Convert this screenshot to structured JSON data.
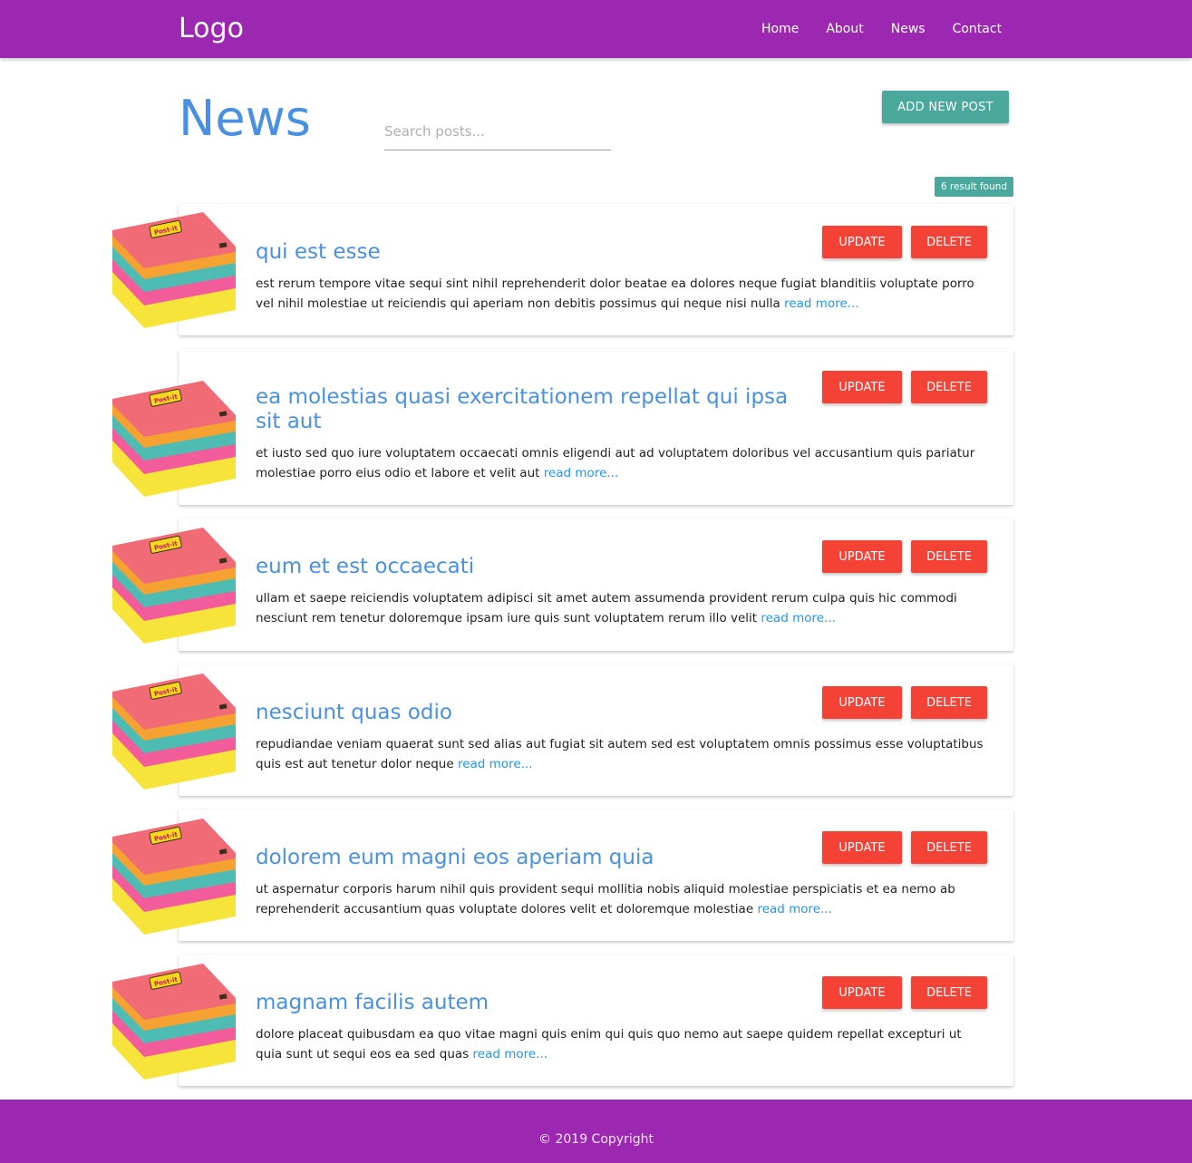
{
  "navbar": {
    "logo": "Logo",
    "links": [
      "Home",
      "About",
      "News",
      "Contact"
    ]
  },
  "header": {
    "title": "News",
    "search_placeholder": "Search posts...",
    "add_button": "ADD NEW POST",
    "result_badge": "6 result found"
  },
  "post_actions": {
    "update_label": "UPDATE",
    "delete_label": "DELETE",
    "read_more_label": "read more..."
  },
  "posts": [
    {
      "title": "qui est esse",
      "excerpt": "est rerum tempore vitae sequi sint nihil reprehenderit dolor beatae ea dolores neque fugiat blanditiis voluptate porro vel nihil molestiae ut reiciendis qui aperiam non debitis possimus qui neque nisi nulla"
    },
    {
      "title": "ea molestias quasi exercitationem repellat qui ipsa sit aut",
      "excerpt": "et iusto sed quo iure voluptatem occaecati omnis eligendi aut ad voluptatem doloribus vel accusantium quis pariatur molestiae porro eius odio et labore et velit aut"
    },
    {
      "title": "eum et est occaecati",
      "excerpt": "ullam et saepe reiciendis voluptatem adipisci sit amet autem assumenda provident rerum culpa quis hic commodi nesciunt rem tenetur doloremque ipsam iure quis sunt voluptatem rerum illo velit"
    },
    {
      "title": "nesciunt quas odio",
      "excerpt": "repudiandae veniam quaerat sunt sed alias aut fugiat sit autem sed est voluptatem omnis possimus esse voluptatibus quis est aut tenetur dolor neque"
    },
    {
      "title": "dolorem eum magni eos aperiam quia",
      "excerpt": "ut aspernatur corporis harum nihil quis provident sequi mollitia nobis aliquid molestiae perspiciatis et ea nemo ab reprehenderit accusantium quas voluptate dolores velit et doloremque molestiae"
    },
    {
      "title": "magnam facilis autem",
      "excerpt": "dolore placeat quibusdam ea quo vitae magni quis enim qui quis quo nemo aut saepe quidem repellat excepturi ut quia sunt ut sequi eos ea sed quas"
    }
  ],
  "post_image": {
    "icon": "post-it-notes-stack",
    "brand_text": "Post-it",
    "colors": {
      "pink": "#f06b76",
      "orange": "#f5a233",
      "teal": "#4fbcb3",
      "hotpink": "#f25c9a",
      "yellow": "#f7e43a"
    }
  },
  "footer": {
    "copyright": "© 2019 Copyright"
  },
  "colors": {
    "primary": "#9c27b0",
    "accent_blue": "#4a90e2",
    "teal": "#4aa89c",
    "danger": "#f44336"
  }
}
